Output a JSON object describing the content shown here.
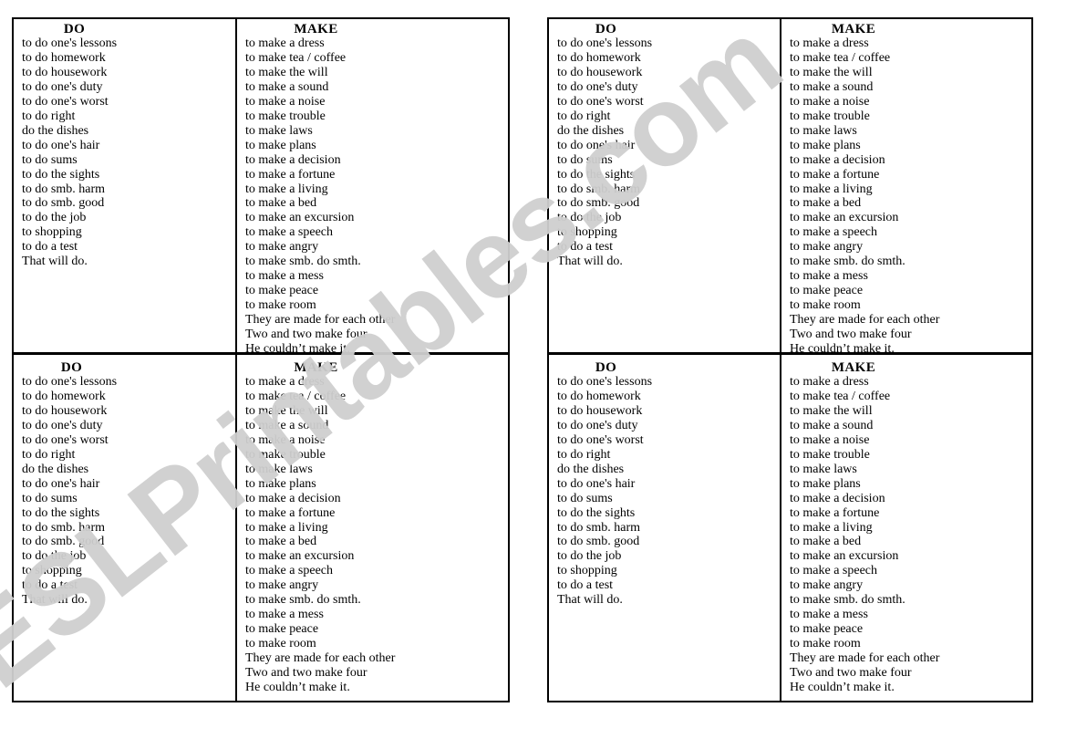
{
  "watermark": {
    "text": "ESLPrintables.com",
    "color": "#cfcfcf"
  },
  "columns": {
    "do_heading": "DO",
    "make_heading": "MAKE"
  },
  "do_items": [
    "to do one's lessons",
    "to do homework",
    "to do housework",
    "to do one's duty",
    "to do one's worst",
    "to do right",
    "do the dishes",
    "to do one's hair",
    "to do sums",
    "to do the sights",
    "to do smb. harm",
    "to do smb. good",
    "to do the job",
    "to shopping",
    "to do a test",
    "That will do."
  ],
  "make_items": [
    "to make a dress",
    "to make tea / coffee",
    "to make the will",
    "to make a sound",
    "to make a noise",
    "to make trouble",
    "to make laws",
    "to make plans",
    "to make a decision",
    "to make a fortune",
    "to make a living",
    "to make a bed",
    "to make an excursion",
    "to make a speech",
    "to make angry",
    "to make smb. do smth.",
    "to make a mess",
    "to make peace",
    "to make room",
    "They are made for each other",
    "Two and two make four",
    "He couldn’t make it."
  ]
}
